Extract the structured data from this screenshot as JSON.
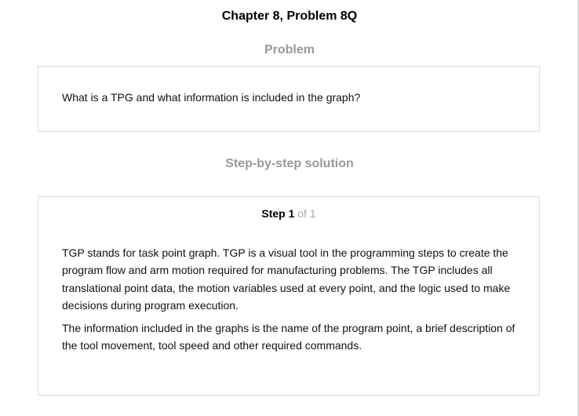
{
  "chapter_title": "Chapter 8, Problem 8Q",
  "problem": {
    "heading": "Problem",
    "text": "What is a TPG and what information is included in the graph?"
  },
  "solution": {
    "heading": "Step-by-step solution",
    "step_label": "Step 1",
    "step_of": "of 1",
    "paragraphs": [
      "TGP stands for task point graph. TGP is a visual tool in the programming steps to create the program flow and arm motion required for manufacturing problems. The TGP includes all translational point data, the motion variables used at every point, and the logic used to make decisions during program execution.",
      "The information included in the graphs is the name of the program point, a brief description of the tool movement, tool speed and other required commands."
    ]
  }
}
